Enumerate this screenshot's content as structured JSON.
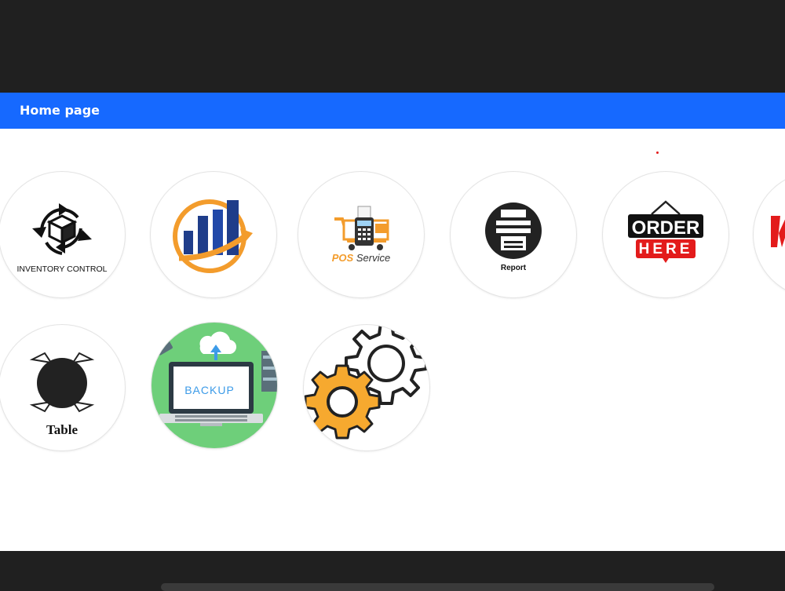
{
  "header": {
    "title": "Home page"
  },
  "tiles": {
    "inventory": {
      "label": "INVENTORY CONTROL",
      "icon": "inventory-box-cycle-icon"
    },
    "sales": {
      "label": "",
      "icon": "growth-chart-icon"
    },
    "pos": {
      "label_main": "POS",
      "label_sub": "Service",
      "icon": "pos-cart-icon"
    },
    "report": {
      "label": "Report",
      "icon": "printer-report-icon"
    },
    "order": {
      "line1": "ORDER",
      "line2": "HERE",
      "icon": "order-sign-icon"
    },
    "table": {
      "label": "Table",
      "icon": "dining-table-icon"
    },
    "backup": {
      "label": "BACKUP",
      "icon": "laptop-cloud-backup-icon"
    },
    "settings": {
      "label": "",
      "icon": "gears-icon"
    }
  },
  "colors": {
    "header_bg": "#1669ff",
    "orange": "#f39c2c",
    "red": "#e31b1b",
    "green": "#6ecf7a",
    "chart_blue": "#1f3d8a"
  }
}
